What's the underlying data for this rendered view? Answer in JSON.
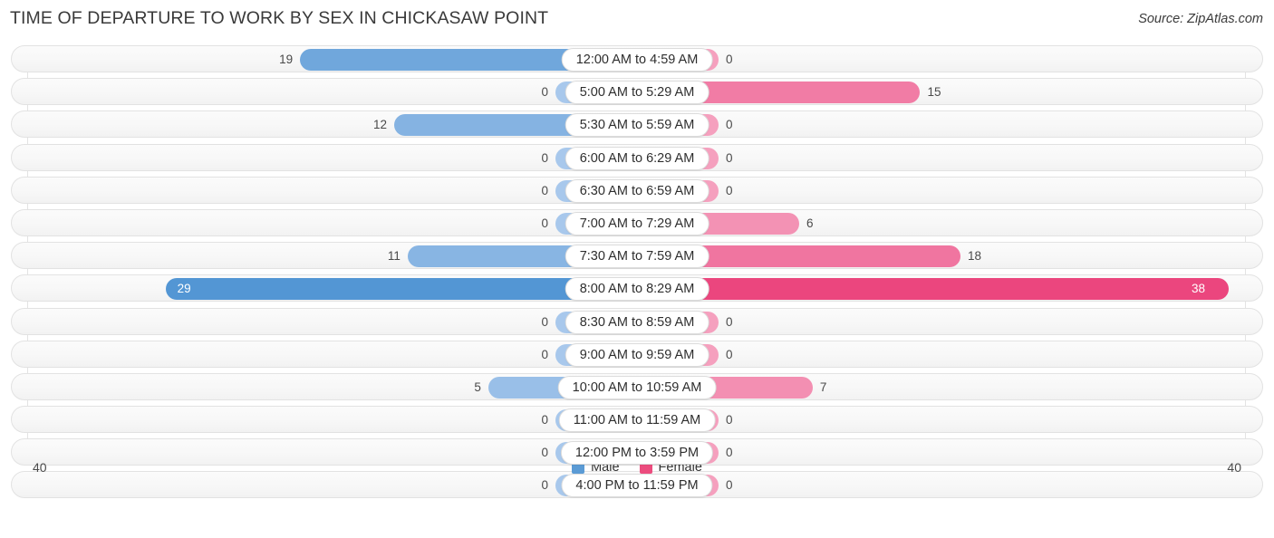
{
  "header": {
    "title": "TIME OF DEPARTURE TO WORK BY SEX IN CHICKASAW POINT",
    "source": "Source: ZipAtlas.com"
  },
  "axis": {
    "left_max": "40",
    "right_max": "40"
  },
  "legend": {
    "items": [
      {
        "label": "Male",
        "color": "#5b9bd5"
      },
      {
        "label": "Female",
        "color": "#ec4c7e"
      }
    ]
  },
  "chart_data": {
    "type": "bar",
    "title": "TIME OF DEPARTURE TO WORK BY SEX IN CHICKASAW POINT",
    "subtitle": "Source: ZipAtlas.com",
    "orientation": "horizontal-diverging",
    "xlabel": "",
    "ylabel": "",
    "xlim": [
      40,
      40
    ],
    "grid": false,
    "legend_position": "bottom-center",
    "categories": [
      "12:00 AM to 4:59 AM",
      "5:00 AM to 5:29 AM",
      "5:30 AM to 5:59 AM",
      "6:00 AM to 6:29 AM",
      "6:30 AM to 6:59 AM",
      "7:00 AM to 7:29 AM",
      "7:30 AM to 7:59 AM",
      "8:00 AM to 8:29 AM",
      "8:30 AM to 8:59 AM",
      "9:00 AM to 9:59 AM",
      "10:00 AM to 10:59 AM",
      "11:00 AM to 11:59 AM",
      "12:00 PM to 3:59 PM",
      "4:00 PM to 11:59 PM"
    ],
    "series": [
      {
        "name": "Male",
        "values": [
          19,
          0,
          12,
          0,
          0,
          0,
          11,
          29,
          0,
          0,
          5,
          0,
          0,
          0
        ]
      },
      {
        "name": "Female",
        "values": [
          0,
          15,
          0,
          0,
          0,
          6,
          18,
          38,
          0,
          0,
          7,
          0,
          0,
          0
        ]
      }
    ]
  }
}
